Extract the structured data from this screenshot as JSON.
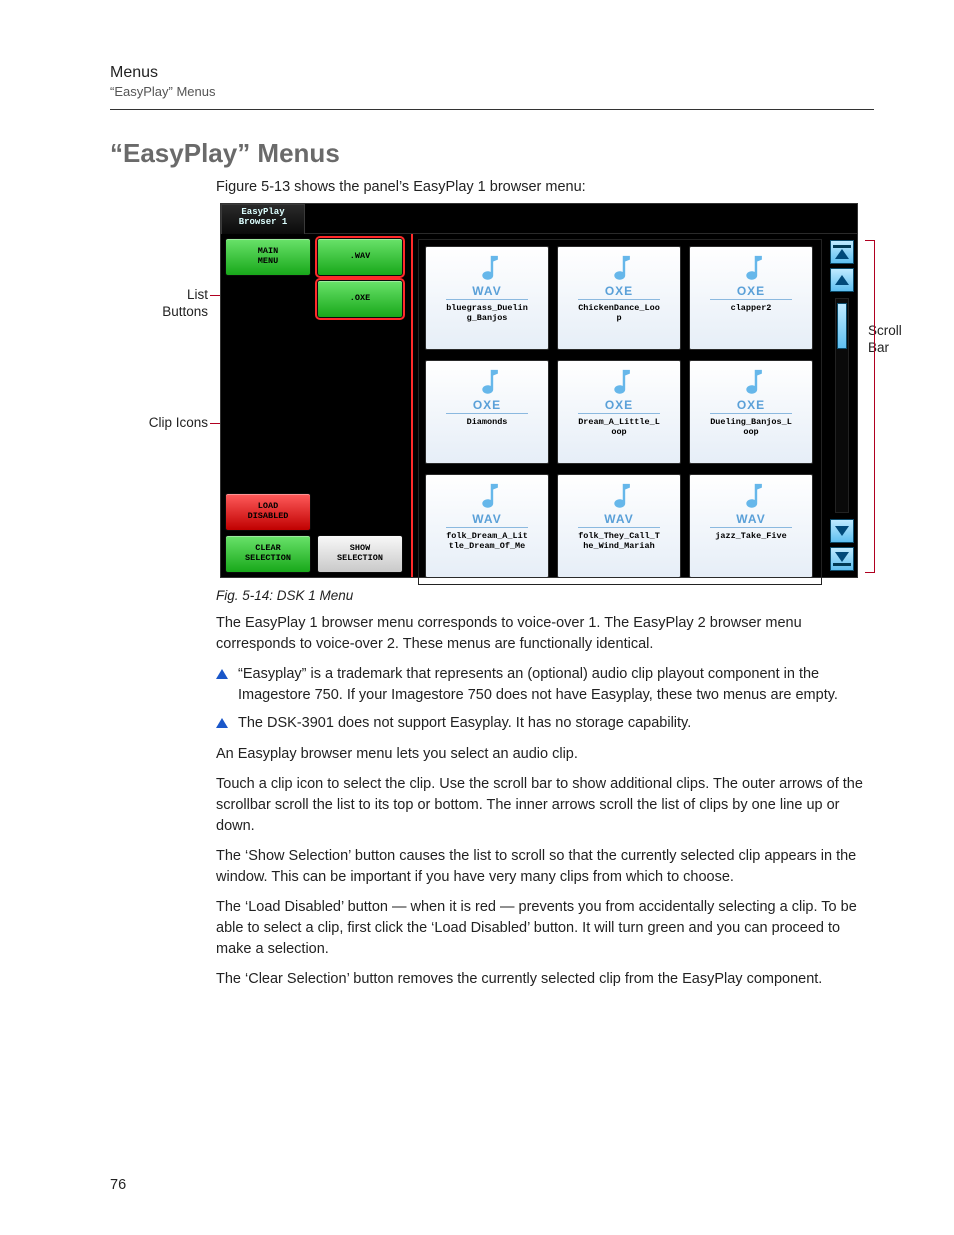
{
  "header": {
    "section": "Menus",
    "sub": "“EasyPlay” Menus"
  },
  "title": "“EasyPlay” Menus",
  "intro": "Figure 5-13 shows the panel’s EasyPlay 1 browser menu:",
  "callouts": {
    "list_buttons": "List\nButtons",
    "clip_icons": "Clip Icons",
    "scroll_bar": "Scroll\nBar"
  },
  "panel": {
    "tab": "EasyPlay\nBrowser 1",
    "buttons": {
      "main_menu": "MAIN\nMENU",
      "wav": ".WAV",
      "oxe": ".OXE",
      "load_disabled": "LOAD\nDISABLED",
      "clear_selection": "CLEAR\nSELECTION",
      "show_selection": "SHOW\nSELECTION"
    },
    "clips": [
      {
        "type": "WAV",
        "name": "bluegrass_Duelin\ng_Banjos"
      },
      {
        "type": "OXE",
        "name": "ChickenDance_Loo\np"
      },
      {
        "type": "OXE",
        "name": "clapper2"
      },
      {
        "type": "OXE",
        "name": "Diamonds"
      },
      {
        "type": "OXE",
        "name": "Dream_A_Little_L\noop"
      },
      {
        "type": "OXE",
        "name": "Dueling_Banjos_L\noop"
      },
      {
        "type": "WAV",
        "name": "folk_Dream_A_Lit\ntle_Dream_Of_Me"
      },
      {
        "type": "WAV",
        "name": "folk_They_Call_T\nhe_Wind_Mariah"
      },
      {
        "type": "WAV",
        "name": "jazz_Take_Five"
      }
    ]
  },
  "fig_caption": "Fig. 5-14: DSK 1 Menu",
  "body": {
    "p1": "The EasyPlay 1 browser menu corresponds to voice-over 1. The EasyPlay 2 browser menu corresponds to voice-over 2. These menus are functionally identical.",
    "b1": "“Easyplay” is a trademark that represents an (optional) audio clip playout component in the Imagestore 750. If your Imagestore 750 does not have Easyplay, these two menus are empty.",
    "b2": "The DSK-3901 does not support Easyplay. It has no storage capability.",
    "p2": "An Easyplay browser menu lets you select an audio clip.",
    "p3": "Touch a clip icon to select the clip. Use the scroll bar to show additional clips. The outer arrows of the scrollbar scroll the list to its top or bottom. The inner arrows scroll the list of clips by one line up or down.",
    "p4": "The ‘Show Selection’ button causes the list to scroll so that the currently selected clip appears in the window. This can be important if you have very many clips from which to choose.",
    "p5": "The ‘Load Disabled’ button — when it is red — prevents you from accidentally selecting a clip. To be able to select a clip, first click the ‘Load Disabled’ button. It will turn green and you can proceed to make a selection.",
    "p6": "The ‘Clear Selection’ button removes the currently selected clip from the EasyPlay component."
  },
  "page_number": "76"
}
